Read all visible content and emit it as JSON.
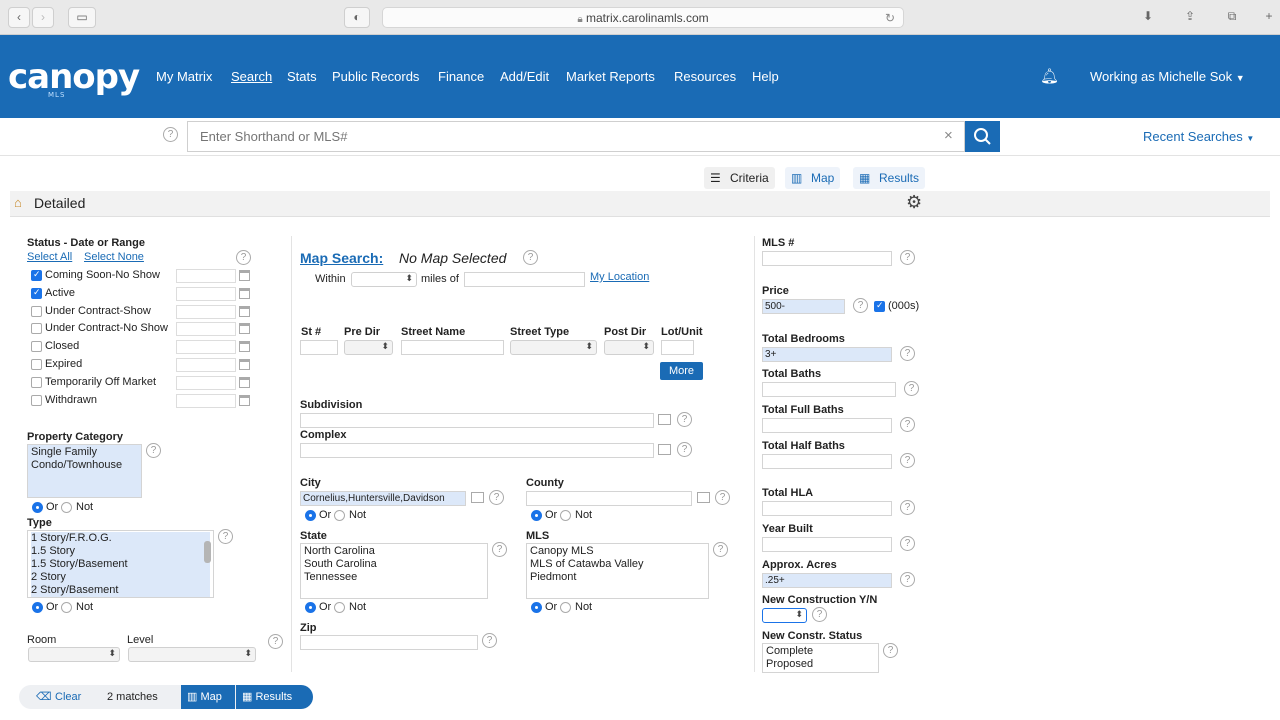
{
  "browser": {
    "url": "matrix.carolinamls.com"
  },
  "app": {
    "logo": "canopy",
    "logo_sub": "MLS",
    "nav": [
      "My Matrix",
      "Search",
      "Stats",
      "Public Records",
      "Finance",
      "Add/Edit",
      "Market Reports",
      "Resources",
      "Help"
    ],
    "active_nav": "Search",
    "user": "Working as Michelle Sok"
  },
  "search": {
    "placeholder": "Enter Shorthand or MLS#",
    "recent": "Recent Searches"
  },
  "view_tabs": {
    "criteria": "Criteria",
    "map": "Map",
    "results": "Results"
  },
  "panel_title": "Detailed",
  "status": {
    "title": "Status - Date or Range",
    "select_all": "Select All",
    "select_none": "Select None",
    "items": [
      {
        "label": "Coming Soon-No Show",
        "checked": true
      },
      {
        "label": "Active",
        "checked": true
      },
      {
        "label": "Under Contract-Show",
        "checked": false
      },
      {
        "label": "Under Contract-No Show",
        "checked": false
      },
      {
        "label": "Closed",
        "checked": false
      },
      {
        "label": "Expired",
        "checked": false
      },
      {
        "label": "Temporarily Off Market",
        "checked": false
      },
      {
        "label": "Withdrawn",
        "checked": false
      }
    ]
  },
  "property_category": {
    "title": "Property Category",
    "options": [
      "Single Family",
      "Condo/Townhouse"
    ]
  },
  "or_label": "Or",
  "not_label": "Not",
  "type": {
    "title": "Type",
    "options": [
      "1 Story/F.R.O.G.",
      "1.5 Story",
      "1.5 Story/Basement",
      "2 Story",
      "2 Story/Basement"
    ]
  },
  "room": {
    "title": "Room",
    "level": "Level"
  },
  "map_search": {
    "title": "Map Search:",
    "status": "No Map Selected",
    "within": "Within",
    "miles_of": "miles of",
    "my_location": "My Location"
  },
  "address": {
    "st_num": "St #",
    "pre_dir": "Pre Dir",
    "street_name": "Street Name",
    "street_type": "Street Type",
    "post_dir": "Post Dir",
    "lot_unit": "Lot/Unit",
    "more": "More"
  },
  "subdivision": "Subdivision",
  "complex": "Complex",
  "city": {
    "title": "City",
    "value": "Cornelius,Huntersville,Davidson"
  },
  "county": {
    "title": "County"
  },
  "state": {
    "title": "State",
    "options": [
      "North Carolina",
      "South Carolina",
      "Tennessee"
    ]
  },
  "mls": {
    "title": "MLS",
    "options": [
      "Canopy MLS",
      "MLS of Catawba Valley",
      "Piedmont"
    ]
  },
  "zip": "Zip",
  "right": {
    "mls_num": "MLS #",
    "price": "Price",
    "price_value": "500-",
    "price_unit": "(000s)",
    "bedrooms": "Total Bedrooms",
    "bedrooms_value": "3+",
    "baths": "Total Baths",
    "full_baths": "Total Full Baths",
    "half_baths": "Total Half Baths",
    "hla": "Total HLA",
    "year_built": "Year Built",
    "acres": "Approx. Acres",
    "acres_value": ".25+",
    "new_construction": "New Construction Y/N",
    "constr_status": "New Constr. Status",
    "constr_options": [
      "Complete",
      "Proposed"
    ]
  },
  "footer": {
    "clear": "Clear",
    "matches": "2 matches",
    "map": "Map",
    "results": "Results"
  },
  "colors": {
    "brand": "#1a6bb5",
    "selected": "#dce8f9"
  }
}
